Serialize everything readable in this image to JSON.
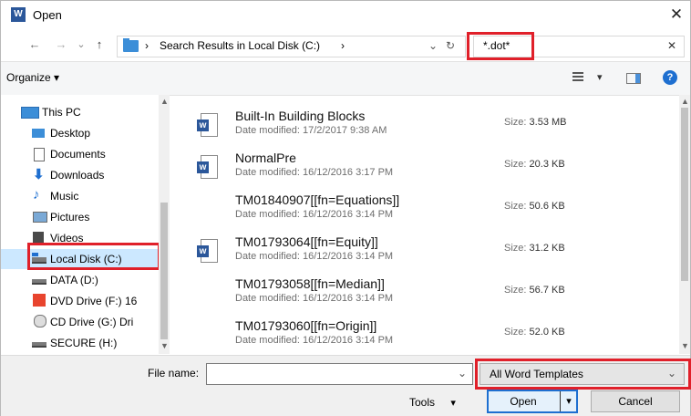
{
  "window": {
    "title": "Open",
    "close_glyph": "✕",
    "app_icon_letter": "W"
  },
  "nav": {
    "back_glyph": "←",
    "forward_glyph": "→",
    "recent_glyph": "⌄",
    "up_glyph": "↑",
    "breadcrumb_sep": "›",
    "breadcrumb_label": "Search Results in Local Disk (C:)",
    "breadcrumb_more": "›",
    "dropdown_glyph": "⌄",
    "refresh_glyph": "↻",
    "search_value": "*.dot*",
    "search_clear_glyph": "✕"
  },
  "toolbar": {
    "organize_label": "Organize ▾",
    "view_glyph": "▾",
    "help_glyph": "?"
  },
  "sidebar": {
    "items": [
      {
        "label": "This PC",
        "icon": "pc-icon",
        "selected": false
      },
      {
        "label": "Desktop",
        "icon": "desktop-icon",
        "selected": false
      },
      {
        "label": "Documents",
        "icon": "documents-icon",
        "selected": false
      },
      {
        "label": "Downloads",
        "icon": "downloads-icon",
        "selected": false
      },
      {
        "label": "Music",
        "icon": "music-icon",
        "selected": false
      },
      {
        "label": "Pictures",
        "icon": "pictures-icon",
        "selected": false
      },
      {
        "label": "Videos",
        "icon": "videos-icon",
        "selected": false
      },
      {
        "label": "Local Disk (C:)",
        "icon": "local-disk-icon",
        "selected": true
      },
      {
        "label": "DATA (D:)",
        "icon": "drive-icon",
        "selected": false
      },
      {
        "label": "DVD Drive (F:) 16",
        "icon": "dvd-drive-icon",
        "selected": false
      },
      {
        "label": "CD Drive (G:) Dri",
        "icon": "cd-drive-icon",
        "selected": false
      },
      {
        "label": "SECURE (H:)",
        "icon": "drive-icon",
        "selected": false
      }
    ]
  },
  "files": [
    {
      "name": "Built-In Building Blocks",
      "date_label": "Date modified:",
      "date": "17/2/2017 9:38 AM",
      "size_label": "Size:",
      "size": "3.53 MB",
      "icon": "word-doc-icon"
    },
    {
      "name": "NormalPre",
      "date_label": "Date modified:",
      "date": "16/12/2016 3:17 PM",
      "size_label": "Size:",
      "size": "20.3 KB",
      "icon": "word-template-icon"
    },
    {
      "name": "TM01840907[[fn=Equations]]",
      "date_label": "Date modified:",
      "date": "16/12/2016 3:14 PM",
      "size_label": "Size:",
      "size": "50.6 KB",
      "icon": ""
    },
    {
      "name": "TM01793064[[fn=Equity]]",
      "date_label": "Date modified:",
      "date": "16/12/2016 3:14 PM",
      "size_label": "Size:",
      "size": "31.2 KB",
      "icon": "word-doc-icon"
    },
    {
      "name": "TM01793058[[fn=Median]]",
      "date_label": "Date modified:",
      "date": "16/12/2016 3:14 PM",
      "size_label": "Size:",
      "size": "56.7 KB",
      "icon": ""
    },
    {
      "name": "TM01793060[[fn=Origin]]",
      "date_label": "Date modified:",
      "date": "16/12/2016 3:14 PM",
      "size_label": "Size:",
      "size": "52.0 KB",
      "icon": ""
    }
  ],
  "bottom": {
    "file_name_label": "File name:",
    "file_name_value": "",
    "file_name_dropdown_glyph": "⌄",
    "filter_value": "All Word Templates",
    "filter_dropdown_glyph": "⌄",
    "tools_label": "Tools",
    "tools_glyph": "▾",
    "open_label": "Open",
    "open_split_glyph": "▾",
    "cancel_label": "Cancel"
  },
  "colors": {
    "highlight": "#e0202a",
    "word_blue": "#2b579a",
    "folder_blue": "#3c8ed8",
    "selected_bg": "#cce8ff"
  }
}
